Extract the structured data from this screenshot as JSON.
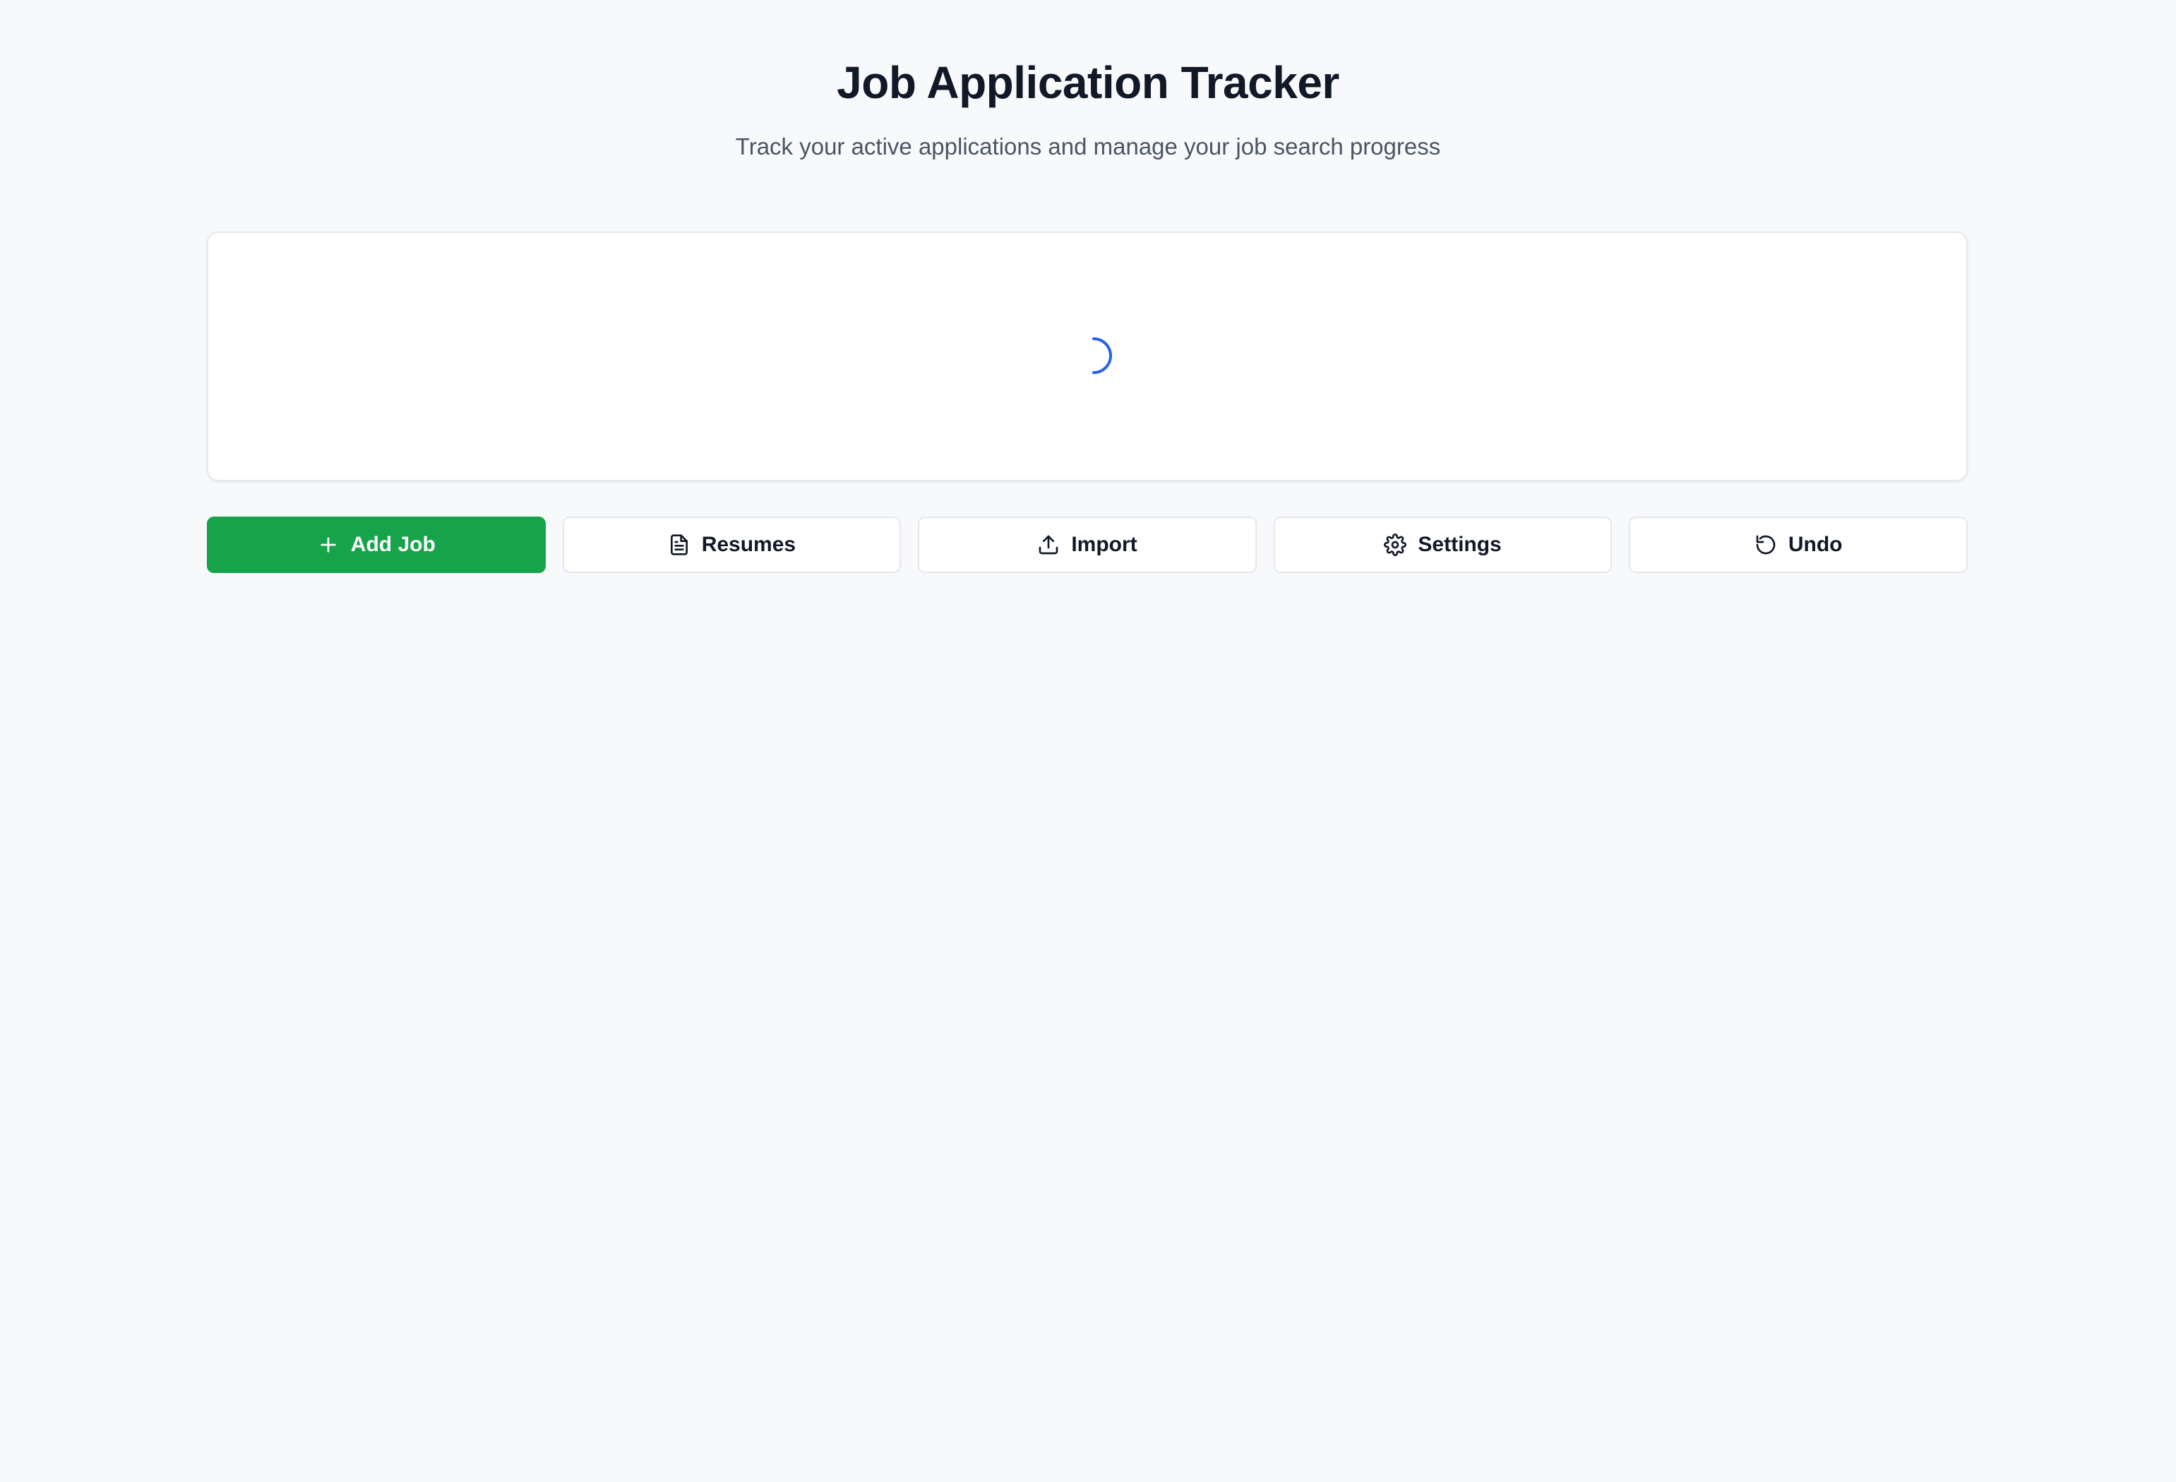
{
  "header": {
    "title": "Job Application Tracker",
    "subtitle": "Track your active applications and manage your job search progress"
  },
  "loading": {
    "spinner_icon": "spinner-icon",
    "spinner_color": "#2563eb"
  },
  "actions": [
    {
      "label": "Add Job",
      "icon": "plus-icon",
      "style": "primary",
      "color": "#16a34a"
    },
    {
      "label": "Resumes",
      "icon": "document-icon",
      "style": "secondary"
    },
    {
      "label": "Import",
      "icon": "upload-icon",
      "style": "secondary"
    },
    {
      "label": "Settings",
      "icon": "gear-icon",
      "style": "secondary"
    },
    {
      "label": "Undo",
      "icon": "undo-icon",
      "style": "secondary"
    }
  ]
}
